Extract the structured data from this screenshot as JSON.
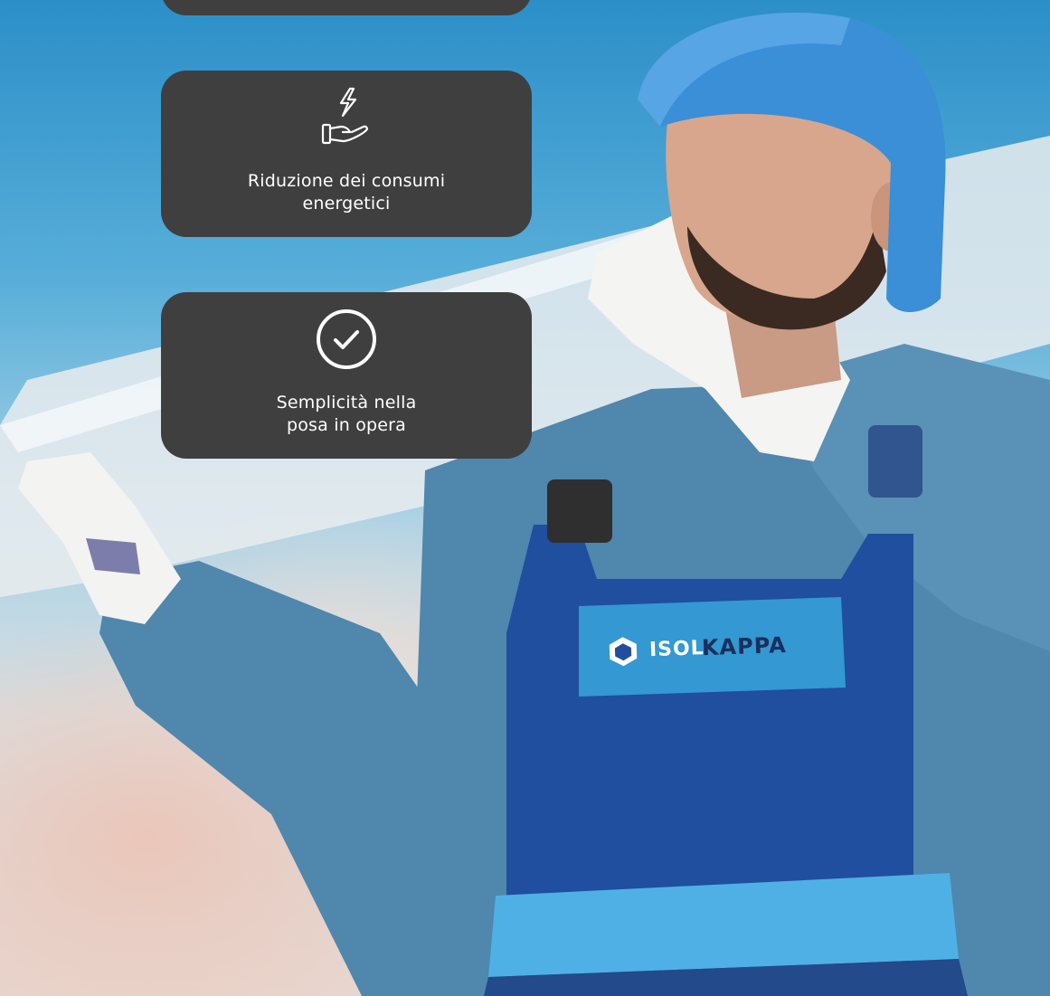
{
  "cards": [
    {
      "label": "",
      "icon": "card-top-partial"
    },
    {
      "label": "Riduzione dei consumi\nenergetici",
      "icon": "energy-saving-hand-icon"
    },
    {
      "label": "Semplicità nella\nposa in opera",
      "icon": "check-circle-icon"
    }
  ],
  "brand": {
    "part1": "ISOL",
    "part2": "KAPPA"
  },
  "colors": {
    "card_bg": "#3f3f3f",
    "card_text": "#ffffff",
    "sky_top": "#2c8fc8",
    "helmet": "#3a8fd6",
    "overalls": "#1f4f9e",
    "overalls_band": "#4fb0e6",
    "shirt": "#4f87ad"
  }
}
